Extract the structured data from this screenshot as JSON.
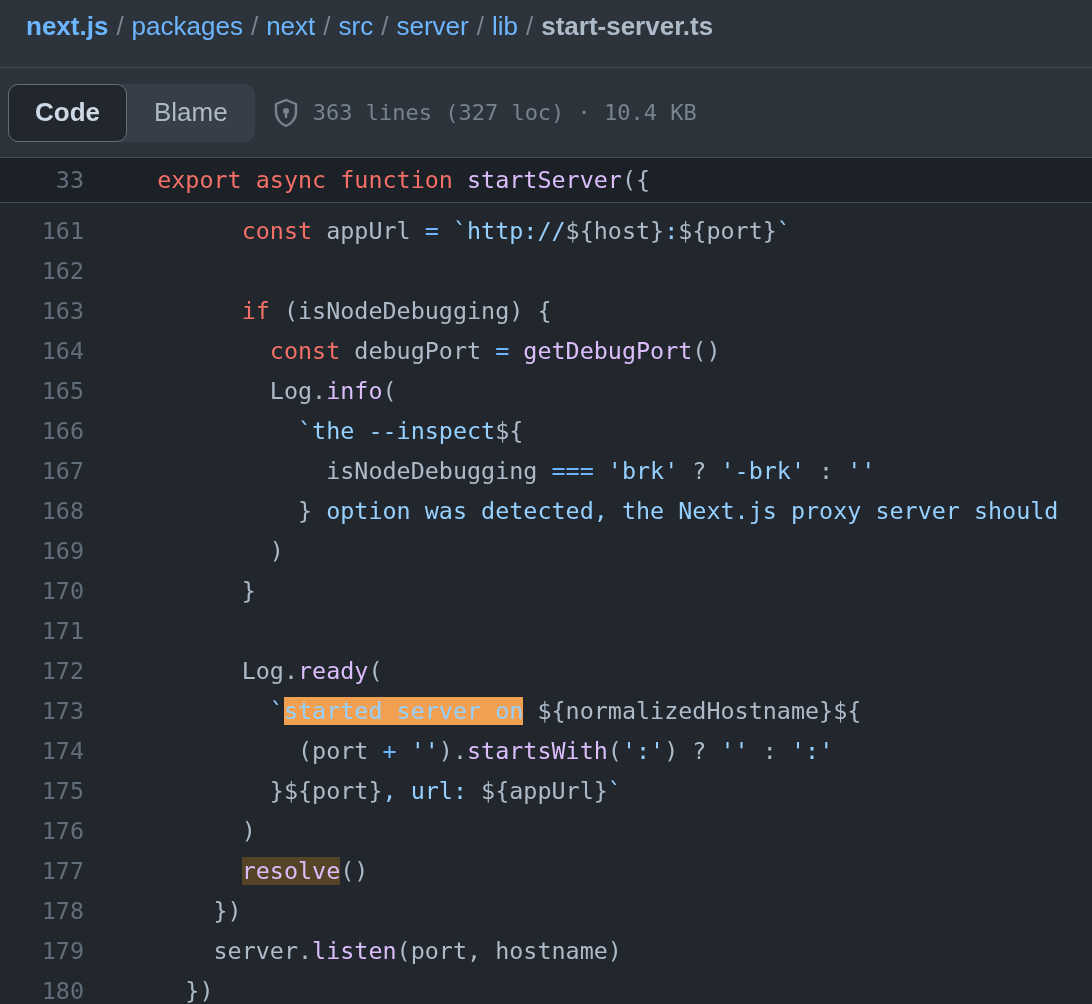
{
  "breadcrumb": [
    {
      "label": "next.js",
      "kind": "repo"
    },
    {
      "label": "/",
      "kind": "sep"
    },
    {
      "label": "packages",
      "kind": "link"
    },
    {
      "label": "/",
      "kind": "sep"
    },
    {
      "label": "next",
      "kind": "link"
    },
    {
      "label": "/",
      "kind": "sep"
    },
    {
      "label": "src",
      "kind": "link"
    },
    {
      "label": "/",
      "kind": "sep"
    },
    {
      "label": "server",
      "kind": "link"
    },
    {
      "label": "/",
      "kind": "sep"
    },
    {
      "label": "lib",
      "kind": "link"
    },
    {
      "label": "/",
      "kind": "sep"
    },
    {
      "label": "start-server.ts",
      "kind": "current"
    }
  ],
  "tabs": [
    {
      "label": "Code",
      "selected": true
    },
    {
      "label": "Blame",
      "selected": false
    }
  ],
  "file_info": "363 lines (327 loc) · 10.4 KB",
  "sticky_line": {
    "number": "33",
    "tokens": [
      {
        "text": "  export async function ",
        "kind": "keyword"
      },
      {
        "text": "startServer",
        "kind": "function"
      },
      {
        "text": "({",
        "kind": "plain"
      }
    ]
  },
  "lines": [
    {
      "number": "161",
      "tokens": [
        {
          "text": "        const ",
          "kind": "keyword"
        },
        {
          "text": "appUrl ",
          "kind": "plain"
        },
        {
          "text": "= ",
          "kind": "operator"
        },
        {
          "text": "`http://",
          "kind": "string"
        },
        {
          "text": "${host}",
          "kind": "plain"
        },
        {
          "text": ":",
          "kind": "string"
        },
        {
          "text": "${port}",
          "kind": "plain"
        },
        {
          "text": "`",
          "kind": "string"
        }
      ]
    },
    {
      "number": "162"
    },
    {
      "number": "163",
      "tokens": [
        {
          "text": "        if",
          "kind": "keyword"
        },
        {
          "text": " (isNodeDebugging) {",
          "kind": "plain"
        }
      ]
    },
    {
      "number": "164",
      "tokens": [
        {
          "text": "          const ",
          "kind": "keyword"
        },
        {
          "text": "debugPort ",
          "kind": "plain"
        },
        {
          "text": "= ",
          "kind": "operator"
        },
        {
          "text": "getDebugPort",
          "kind": "function"
        },
        {
          "text": "()",
          "kind": "plain"
        }
      ]
    },
    {
      "number": "165",
      "tokens": [
        {
          "text": "          Log.",
          "kind": "plain"
        },
        {
          "text": "info",
          "kind": "function"
        },
        {
          "text": "(",
          "kind": "plain"
        }
      ]
    },
    {
      "number": "166",
      "tokens": [
        {
          "text": "            `the --inspect",
          "kind": "string"
        },
        {
          "text": "${",
          "kind": "plain"
        }
      ]
    },
    {
      "number": "167",
      "tokens": [
        {
          "text": "              isNodeDebugging ",
          "kind": "plain"
        },
        {
          "text": "=== ",
          "kind": "operator"
        },
        {
          "text": "'brk'",
          "kind": "string"
        },
        {
          "text": " ? ",
          "kind": "plain"
        },
        {
          "text": "'-brk'",
          "kind": "string"
        },
        {
          "text": " : ",
          "kind": "plain"
        },
        {
          "text": "''",
          "kind": "string"
        }
      ]
    },
    {
      "number": "168",
      "tokens": [
        {
          "text": "            } ",
          "kind": "plain"
        },
        {
          "text": "option was detected, the Next.js proxy server should",
          "kind": "string"
        }
      ]
    },
    {
      "number": "169",
      "tokens": [
        {
          "text": "          )",
          "kind": "plain"
        }
      ]
    },
    {
      "number": "170",
      "tokens": [
        {
          "text": "        }",
          "kind": "plain"
        }
      ]
    },
    {
      "number": "171"
    },
    {
      "number": "172",
      "tokens": [
        {
          "text": "        Log.",
          "kind": "plain"
        },
        {
          "text": "ready",
          "kind": "function"
        },
        {
          "text": "(",
          "kind": "plain"
        }
      ]
    },
    {
      "number": "173",
      "tokens": [
        {
          "text": "          `",
          "kind": "string"
        },
        {
          "text": "started server on",
          "kind": "string",
          "highlighted": true,
          "current": true
        },
        {
          "text": " ${normalizedHostname}${",
          "kind": "plain"
        }
      ]
    },
    {
      "number": "174",
      "tokens": [
        {
          "text": "            (port ",
          "kind": "plain"
        },
        {
          "text": "+ ",
          "kind": "operator"
        },
        {
          "text": "''",
          "kind": "string"
        },
        {
          "text": ").",
          "kind": "plain"
        },
        {
          "text": "startsWith",
          "kind": "function"
        },
        {
          "text": "(",
          "kind": "plain"
        },
        {
          "text": "':'",
          "kind": "string"
        },
        {
          "text": ") ? ",
          "kind": "plain"
        },
        {
          "text": "''",
          "kind": "string"
        },
        {
          "text": " : ",
          "kind": "plain"
        },
        {
          "text": "':'",
          "kind": "string"
        }
      ]
    },
    {
      "number": "175",
      "tokens": [
        {
          "text": "          }${port}",
          "kind": "plain"
        },
        {
          "text": ", url: ",
          "kind": "string"
        },
        {
          "text": "${appUrl}",
          "kind": "plain"
        },
        {
          "text": "`",
          "kind": "string"
        }
      ]
    },
    {
      "number": "176",
      "tokens": [
        {
          "text": "        )",
          "kind": "plain"
        }
      ]
    },
    {
      "number": "177",
      "tokens": [
        {
          "text": "        resolve",
          "kind": "function",
          "highlighted": true,
          "current": false
        },
        {
          "text": "()",
          "kind": "plain"
        }
      ]
    },
    {
      "number": "178",
      "tokens": [
        {
          "text": "      })",
          "kind": "plain"
        }
      ]
    },
    {
      "number": "179",
      "tokens": [
        {
          "text": "      server.",
          "kind": "plain"
        },
        {
          "text": "listen",
          "kind": "function"
        },
        {
          "text": "(port, hostname)",
          "kind": "plain"
        }
      ]
    },
    {
      "number": "180",
      "tokens": [
        {
          "text": "    })",
          "kind": "plain"
        }
      ]
    }
  ]
}
